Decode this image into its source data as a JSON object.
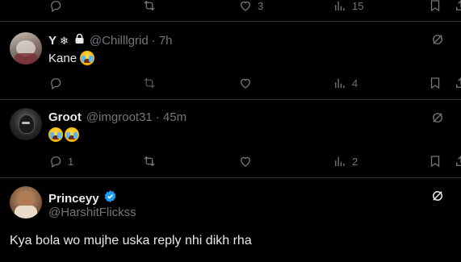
{
  "top_actions": {
    "like_count": "3",
    "views_count": "15"
  },
  "tweets": [
    {
      "name": "Y",
      "badges": [
        "snowflake-icon",
        "lock-icon"
      ],
      "handle": "@Chilllgrid",
      "time": "· 7h",
      "text": "Kane",
      "emoji": [
        "loudly-crying-face"
      ],
      "reply_count": "",
      "repost_count": "",
      "like_count": "",
      "views_count": "4"
    },
    {
      "name": "Groot",
      "handle": "@imgroot31",
      "time": "· 45m",
      "text": "",
      "emoji": [
        "loudly-crying-face",
        "loudly-crying-face"
      ],
      "reply_count": "1",
      "repost_count": "",
      "like_count": "",
      "views_count": "2"
    }
  ],
  "main_tweet": {
    "name": "Princeyy",
    "verified": true,
    "handle": "@HarshitFlickss",
    "text": "Kya bola wo mujhe uska reply nhi dikh rha"
  },
  "colors": {
    "background": "#000000",
    "text": "#e7e9ea",
    "muted": "#71767b",
    "verified": "#1d9bf0",
    "divider": "#2f3336"
  }
}
